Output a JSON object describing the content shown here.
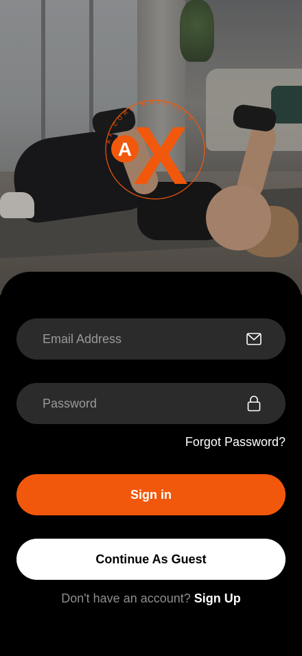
{
  "brand": {
    "ring_text": "AX CORE WORKOUTS",
    "letter_a": "A",
    "letter_x": "X",
    "accent_color": "#f2580c"
  },
  "login": {
    "email": {
      "placeholder": "Email Address",
      "value": "",
      "icon": "mail-icon"
    },
    "password": {
      "placeholder": "Password",
      "value": "",
      "icon": "lock-icon"
    },
    "forgot_label": "Forgot Password?",
    "sign_in_label": "Sign in",
    "guest_label": "Continue As Guest",
    "no_account_text": "Don't have an account?",
    "sign_up_label": "Sign Up"
  }
}
